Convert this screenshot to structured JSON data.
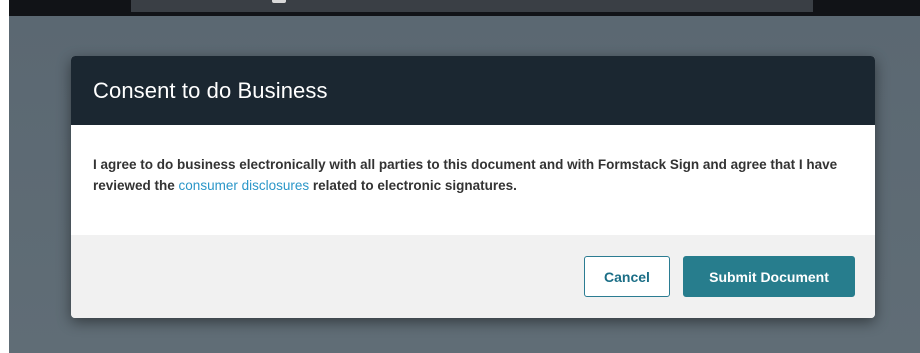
{
  "modal": {
    "title": "Consent to do Business",
    "body": {
      "text_before_link": "I agree to do business electronically with all parties to this document and with Formstack Sign and agree that I have reviewed the ",
      "link_text": "consumer disclosures",
      "text_after_link": " related to electronic signatures."
    },
    "buttons": {
      "cancel_label": "Cancel",
      "submit_label": "Submit Document"
    }
  },
  "colors": {
    "header_bg": "#1b2731",
    "backdrop": "#5f6c75",
    "link": "#2a96c8",
    "primary_button": "#277d8d",
    "cancel_border": "#2b7c92"
  }
}
